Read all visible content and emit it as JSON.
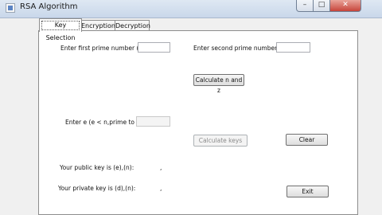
{
  "window": {
    "title": "RSA Algorithm",
    "controls": {
      "minimize": "–",
      "maximize": "□",
      "close": "✕"
    }
  },
  "tabs": [
    {
      "label": "Key Selection",
      "active": true
    },
    {
      "label": "Encryption",
      "active": false
    },
    {
      "label": "Decryption",
      "active": false
    }
  ],
  "key_selection": {
    "first_prime_label": "Enter first prime number (p):",
    "first_prime_value": "",
    "second_prime_label": "Enter second prime number (q):",
    "second_prime_value": "",
    "calc_nz_button": "Calculate n and z",
    "e_label": "Enter e (e < n,prime to z):",
    "e_value": "",
    "calc_keys_button": "Calculate keys",
    "clear_button": "Clear",
    "public_key_label": "Your public  key is (e),(n):",
    "public_key_sep": ",",
    "private_key_label": "Your private key is (d),(n):",
    "private_key_sep": ",",
    "exit_button": "Exit"
  }
}
